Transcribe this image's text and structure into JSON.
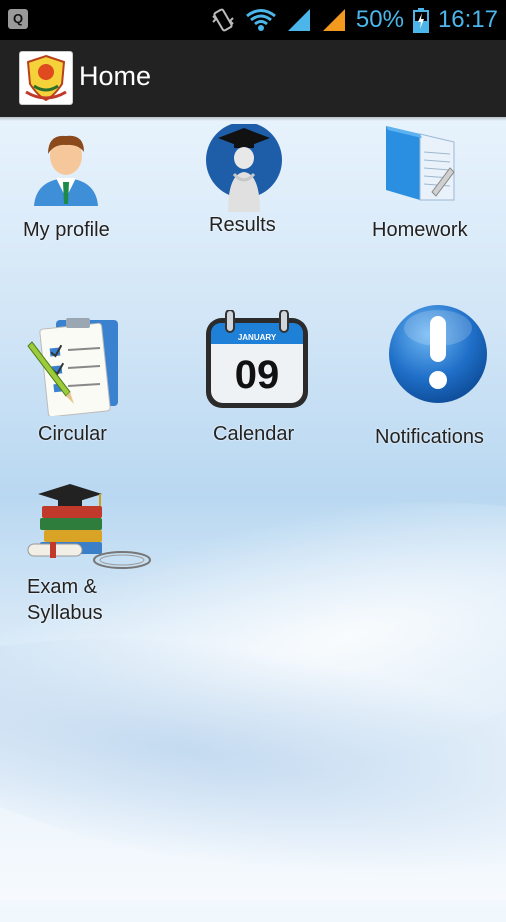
{
  "status_bar": {
    "left_badge": "Q",
    "battery": "50%",
    "time": "16:17",
    "icons": [
      "vibrate-icon",
      "wifi-icon",
      "signal-icon",
      "signal-orange-icon",
      "battery-icon"
    ]
  },
  "action_bar": {
    "title": "Home",
    "logo_icon": "school-crest-icon"
  },
  "menu": {
    "items": [
      {
        "label": "My profile",
        "icon": "profile-icon"
      },
      {
        "label": "Results",
        "icon": "results-icon"
      },
      {
        "label": "Homework",
        "icon": "homework-icon"
      },
      {
        "label": "Circular",
        "icon": "circular-icon"
      },
      {
        "label": "Calendar",
        "icon": "calendar-icon",
        "calendar_month": "JANUARY",
        "calendar_day": "09"
      },
      {
        "label": "Notifications",
        "icon": "notifications-icon"
      },
      {
        "label_line1": "Exam &",
        "label_line2": "Syllabus",
        "icon": "exam-syllabus-icon"
      }
    ]
  },
  "colors": {
    "status_text": "#4cb6ea",
    "action_bar_bg": "#222222",
    "signal_orange": "#f39a1e"
  }
}
